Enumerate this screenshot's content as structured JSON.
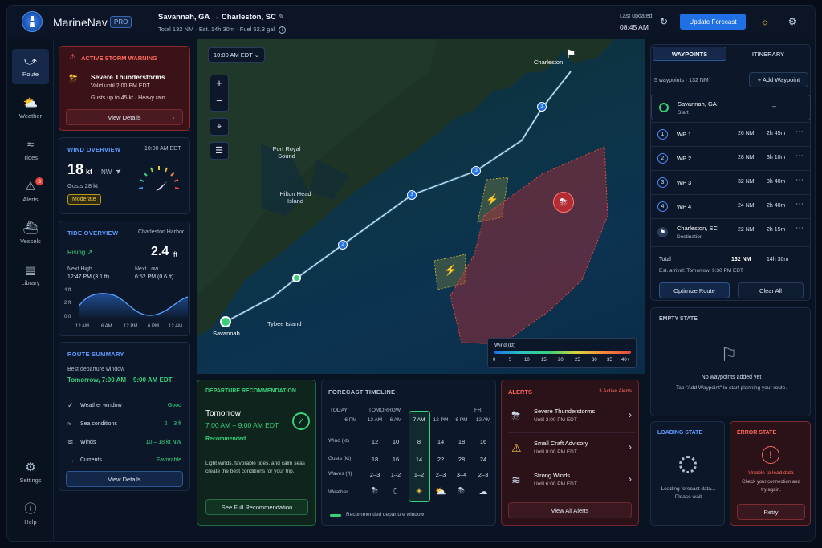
{
  "app": {
    "name": "MarineNav",
    "tier": "PRO"
  },
  "header": {
    "route_from": "Savannah, GA",
    "route_arrow": "→",
    "route_to": "Charleston, SC",
    "total": "Total 132 NM",
    "est": "Est. 14h 30m",
    "fuel": "Fuel 52.3 gal",
    "last_updated_label": "Last updated",
    "last_updated_time": "08:45 AM",
    "update_button": "Update Forecast"
  },
  "nav": [
    {
      "label": "Route",
      "icon": "route-icon"
    },
    {
      "label": "Weather",
      "icon": "weather-icon"
    },
    {
      "label": "Tides",
      "icon": "tides-icon"
    },
    {
      "label": "Alerts",
      "icon": "alert-icon",
      "badge": "3"
    },
    {
      "label": "Vessels",
      "icon": "vessel-icon"
    },
    {
      "label": "Library",
      "icon": "library-icon"
    },
    {
      "label": "Settings",
      "icon": "settings-icon"
    },
    {
      "label": "Help",
      "icon": "help-icon"
    }
  ],
  "storm": {
    "title": "ACTIVE STORM WARNING",
    "name": "Severe Thunderstorms",
    "valid": "Valid until 2:00 PM EDT",
    "gusts": "Gusts up to 45 kt",
    "rain": "Heavy rain",
    "button": "View Details",
    "color": "#e5483e"
  },
  "wind": {
    "title": "WIND OVERVIEW",
    "time": "10:00 AM EDT",
    "speed": "18",
    "unit": "kt",
    "dir": "NW",
    "gusts": "Gusts 28 kt",
    "level": "Moderate"
  },
  "tide": {
    "title": "TIDE OVERVIEW",
    "place": "Charleston Harbor",
    "state": "Rising",
    "height": "2.4",
    "unit": "ft",
    "high_label": "Next High",
    "high_val": "12:47 PM (3.1 ft)",
    "low_label": "Next Low",
    "low_val": "6:52 PM (0.6 ft)",
    "yticks": [
      "4 ft",
      "2 ft",
      "0 ft"
    ],
    "xticks": [
      "12 AM",
      "6 AM",
      "12 PM",
      "6 PM",
      "12 AM"
    ]
  },
  "summary": {
    "title": "ROUTE SUMMARY",
    "best_label": "Best departure window",
    "best_val": "Tomorrow, 7:00 AM – 9:00 AM EDT",
    "rows": [
      {
        "label": "Weather window",
        "value": "Good"
      },
      {
        "label": "Sea conditions",
        "value": "2 – 3 ft"
      },
      {
        "label": "Winds",
        "value": "10 – 18 kt NW"
      },
      {
        "label": "Currents",
        "value": "Favorable"
      }
    ],
    "button": "View Details"
  },
  "map": {
    "time": "10:00 AM EDT",
    "places": [
      "Charleston",
      "Port Royal Sound",
      "Hilton Head Island",
      "Tybee Island",
      "Savannah"
    ],
    "legend_title": "Wind (kt)",
    "legend_ticks": [
      "0",
      "5",
      "10",
      "15",
      "20",
      "25",
      "30",
      "35",
      "40+"
    ]
  },
  "departure": {
    "title": "DEPARTURE RECOMMENDATION",
    "day": "Tomorrow",
    "window": "7:00 AM – 9:00 AM EDT",
    "status": "Recommended",
    "desc1": "Light winds, favorable tides, and calm seas",
    "desc2": "create the best conditions for your trip.",
    "button": "See Full Recommendation"
  },
  "timeline": {
    "title": "FORECAST TIMELINE",
    "days": [
      "TODAY",
      "TOMORROW",
      "FRI"
    ],
    "times": [
      "6 PM",
      "12 AM",
      "6 AM",
      "7 AM",
      "12 PM",
      "6 PM",
      "12 AM"
    ],
    "rows": [
      {
        "label": "Wind (kt)",
        "values": [
          "12",
          "10",
          "8",
          "14",
          "18",
          "16"
        ]
      },
      {
        "label": "Gusts (kt)",
        "values": [
          "18",
          "16",
          "14",
          "22",
          "28",
          "24"
        ]
      },
      {
        "label": "Waves (ft)",
        "values": [
          "2–3",
          "1–2",
          "1–2",
          "2–3",
          "3–4",
          "2–3"
        ]
      }
    ],
    "weather_label": "Weather",
    "legend": "Recommended departure window"
  },
  "alerts": {
    "title": "ALERTS",
    "count": "3 Active Alerts",
    "items": [
      {
        "name": "Severe Thunderstorms",
        "until": "Until 2:00 PM EDT"
      },
      {
        "name": "Small Craft Advisory",
        "until": "Until 8:00 PM EDT"
      },
      {
        "name": "Strong Winds",
        "until": "Until 6:00 PM EDT"
      }
    ],
    "button": "View All Alerts"
  },
  "waypoints": {
    "tab1": "WAYPOINTS",
    "tab2": "ITINERARY",
    "summary": "5 waypoints · 132 NM",
    "add": "+ Add Waypoint",
    "start_name": "Savannah, GA",
    "start_sub": "Start",
    "list": [
      {
        "n": "1",
        "name": "WP 1",
        "dist": "26 NM",
        "time": "2h 45m"
      },
      {
        "n": "2",
        "name": "WP 2",
        "dist": "28 NM",
        "time": "3h 10m"
      },
      {
        "n": "3",
        "name": "WP 3",
        "dist": "32 NM",
        "time": "3h 40m"
      },
      {
        "n": "4",
        "name": "WP 4",
        "dist": "24 NM",
        "time": "2h 40m"
      }
    ],
    "dest_name": "Charleston, SC",
    "dest_sub": "Destination",
    "dest_dist": "22 NM",
    "dest_time": "2h 15m",
    "total_label": "Total",
    "total_dist": "132 NM",
    "total_time": "14h 30m",
    "arrival": "Est. arrival: Tomorrow, 9:30 PM EDT",
    "optimize": "Optimize Route",
    "clear": "Clear All"
  },
  "empty": {
    "title": "EMPTY STATE",
    "msg": "No waypoints added yet",
    "hint": "Tap \"Add Waypoint\" to start planning your route."
  },
  "loading": {
    "title": "LOADING STATE",
    "msg1": "Loading forecast data...",
    "msg2": "Please wait"
  },
  "error": {
    "title": "ERROR STATE",
    "msg": "Unable to load data",
    "hint1": "Check your connection and",
    "hint2": "try again.",
    "button": "Retry"
  }
}
